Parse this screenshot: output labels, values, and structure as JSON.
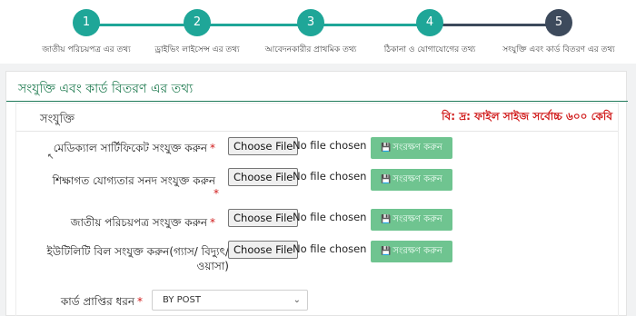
{
  "stepper": {
    "steps": [
      {
        "number": "1",
        "label": "জাতীয় পরিচয়পত্র এর তথ্য"
      },
      {
        "number": "2",
        "label": "ড্রাইভিং লাইসেন্স এর তথ্য"
      },
      {
        "number": "3",
        "label": "আবেদনকারীর প্রাথমিক তথ্য"
      },
      {
        "number": "4",
        "label": "ঠিকানা ও যোগাযোগের তথ্য"
      },
      {
        "number": "5",
        "label": "সংযুক্তি এবং কার্ড বিতরণ এর তথ্য"
      }
    ],
    "completed_color": "#1fa698",
    "active_color": "#3d4a5c"
  },
  "card": {
    "title": "সংযুক্তি এবং কার্ড বিতরণ এর তথ্য",
    "panel_title": "সংযুক্তি",
    "notice": "বি: দ্র: ফাইল সাইজ সর্বোচ্চ ৬০০ কেবি"
  },
  "upload": {
    "choose_label": "Choose File",
    "no_file_text": "No file chosen",
    "save_label": "সংরক্ষণ করুন",
    "required_mark": "*",
    "fields": [
      {
        "label": "মেডিক্যাল সার্টিফিকেট সংযুক্ত করুন"
      },
      {
        "label": "শিক্ষাগত যোগ্যতার সনদ সংযুক্ত করুন"
      },
      {
        "label": "জাতীয় পরিচয়পত্র সংযুক্ত করুন"
      },
      {
        "label": "ইউটিলিটি বিল সংযুক্ত করুন(গ্যাস/ বিদ্যুৎ/ওয়াসা)"
      }
    ]
  },
  "card_receive": {
    "label": "কার্ড প্রাপ্তির ধরন",
    "selected": "BY POST"
  }
}
